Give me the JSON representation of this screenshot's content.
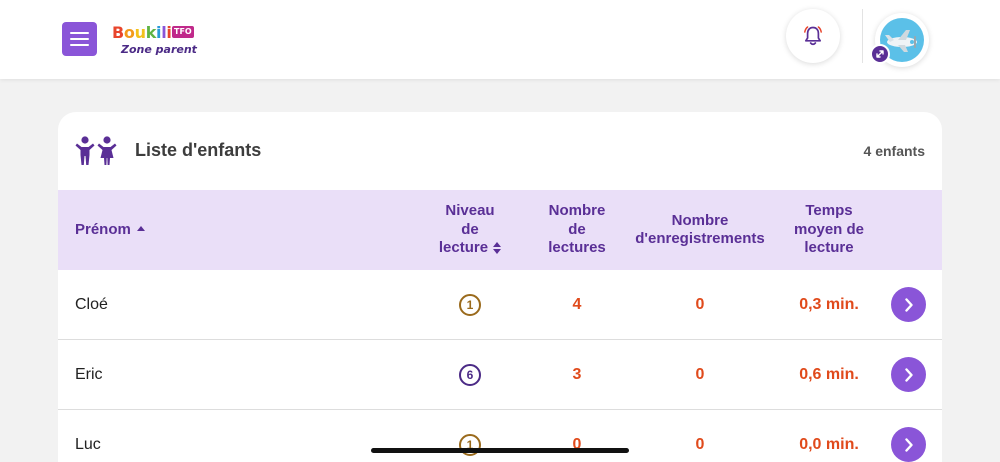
{
  "brand": {
    "logo_letters": [
      "B",
      "o",
      "u",
      "k",
      "i",
      "l",
      "i"
    ],
    "logo_colors": [
      "#e8452c",
      "#f39a1b",
      "#f3c21b",
      "#5fb344",
      "#2a9bd8",
      "#8a55d8",
      "#e8452c"
    ],
    "logo_badge": "TFO",
    "subtitle": "Zone parent"
  },
  "header": {
    "menu_icon": "hamburger-icon",
    "bell_icon": "bell-icon",
    "swap_icon": "swap-arrows-icon"
  },
  "card": {
    "title": "Liste d'enfants",
    "count": "4 enfants",
    "icon": "children-icon"
  },
  "table": {
    "headers": {
      "name": "Prénom",
      "level": [
        "Niveau",
        "de",
        "lecture"
      ],
      "reads": [
        "Nombre",
        "de",
        "lectures"
      ],
      "recordings": [
        "Nombre",
        "d'enregistrements"
      ],
      "time": [
        "Temps",
        "moyen de",
        "lecture"
      ]
    },
    "rows": [
      {
        "name": "Cloé",
        "level": "1",
        "level_color": "#9a6a1c",
        "reads": "4",
        "recordings": "0",
        "time": "0,3 min."
      },
      {
        "name": "Eric",
        "level": "6",
        "level_color": "#4b2a86",
        "reads": "3",
        "recordings": "0",
        "time": "0,6 min."
      },
      {
        "name": "Luc",
        "level": "1",
        "level_color": "#9a6a1c",
        "reads": "0",
        "recordings": "0",
        "time": "0,0 min."
      }
    ]
  },
  "colors": {
    "accent": "#8a55d8",
    "header_bg": "#eadff8",
    "header_text": "#5a2f96",
    "value_text": "#e04a1b"
  }
}
